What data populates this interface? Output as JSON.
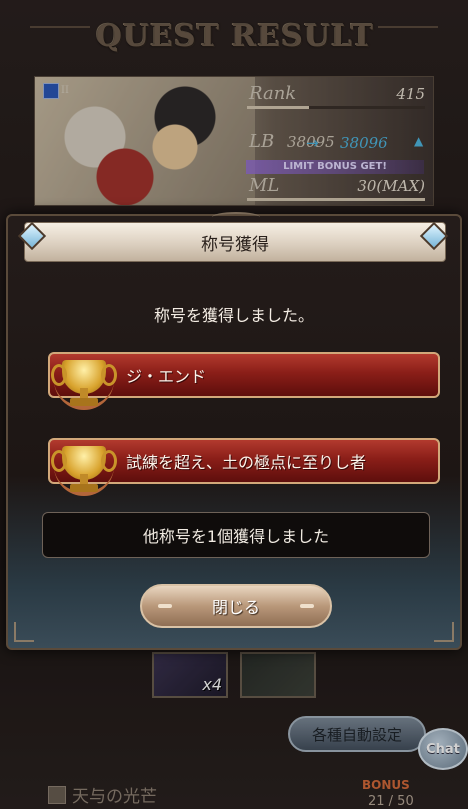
{
  "screen": {
    "title": "QUEST RESULT"
  },
  "character": {
    "rank_label": "Rank",
    "rank_value": "415",
    "rank_progress": 0.35,
    "lb_label": "LB",
    "lb_old": "38095",
    "lb_arrow": "→",
    "lb_new": "38096",
    "lb_up_icon": "▲",
    "limit_bonus_text": "LIMIT BONUS GET!",
    "ml_label": "ML",
    "ml_value": "30(MAX)",
    "icon_number": "II"
  },
  "modal": {
    "header": "称号獲得",
    "message": "称号を獲得しました。",
    "titles": [
      {
        "name": "ジ・エンド"
      },
      {
        "name": "試練を超え、土の極点に至りし者"
      }
    ],
    "others": "他称号を1個獲得しました",
    "close_button": "閉じる"
  },
  "background": {
    "item_count": "x4",
    "auto_settings_button": "各種自動設定",
    "chat_button": "Chat",
    "footer_item": "天与の光芒",
    "bonus_label": "BONUS",
    "bonus_count": "21 / 50"
  }
}
